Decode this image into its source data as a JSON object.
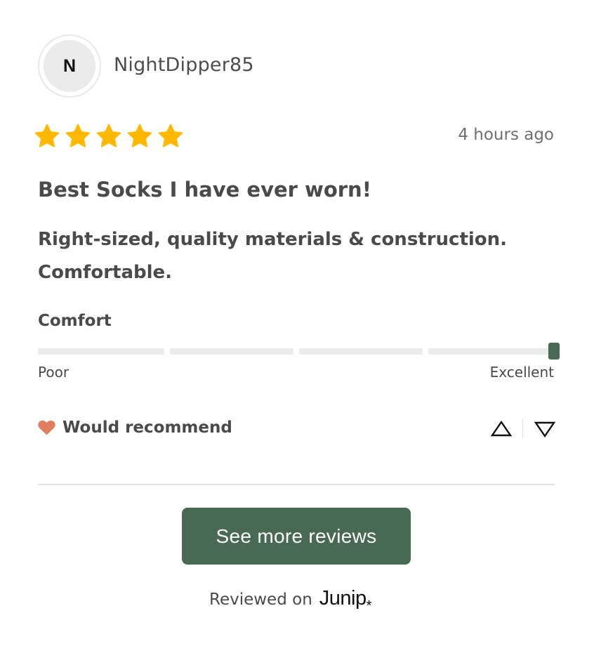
{
  "review": {
    "author_initial": "N",
    "author_name": "NightDipper85",
    "rating": 5,
    "rating_max": 5,
    "time_ago": "4 hours ago",
    "title": "Best Socks I have ever worn!",
    "body": "Right-sized, quality materials & construction. Comfortable."
  },
  "comfort_scale": {
    "label": "Comfort",
    "low_label": "Poor",
    "high_label": "Excellent",
    "value_fraction": 1.0
  },
  "recommendation": {
    "icon": "heart-icon",
    "text": "Would recommend"
  },
  "voting": {
    "upvote_icon": "triangle-up-icon",
    "downvote_icon": "triangle-down-icon"
  },
  "actions": {
    "see_more_label": "See more reviews"
  },
  "footer": {
    "prefix": "Reviewed on",
    "brand": "Junip",
    "brand_mark": "*"
  },
  "colors": {
    "star": "#FFB800",
    "accent": "#486A55",
    "heart": "#E07F60",
    "text": "#4A4A4A"
  }
}
